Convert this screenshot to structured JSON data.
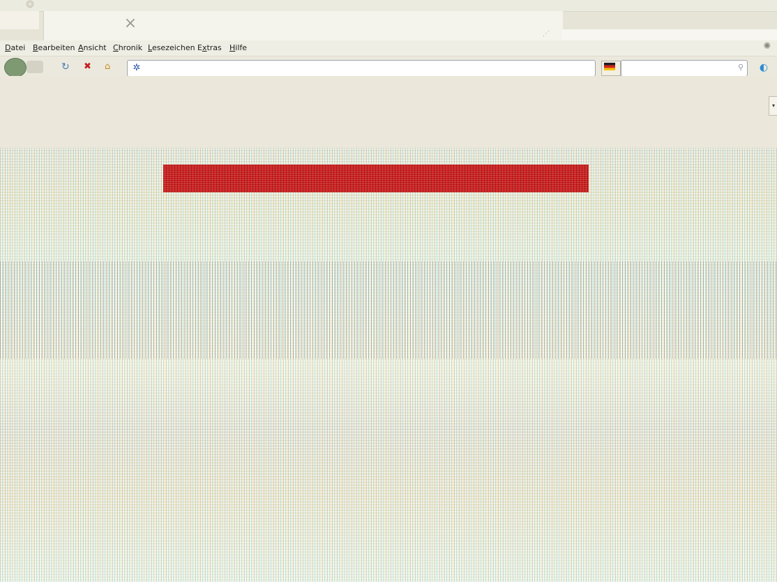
{
  "menubar": {
    "items": [
      {
        "pre": "",
        "acc": "D",
        "post": "atei"
      },
      {
        "pre": "",
        "acc": "B",
        "post": "earbeiten"
      },
      {
        "pre": "",
        "acc": "A",
        "post": "nsicht"
      },
      {
        "pre": "",
        "acc": "C",
        "post": "hronik"
      },
      {
        "pre": "",
        "acc": "L",
        "post": "esezeichen"
      },
      {
        "pre": "E",
        "acc": "x",
        "post": "tras"
      },
      {
        "pre": "",
        "acc": "H",
        "post": "ilfe"
      }
    ]
  },
  "icons": {
    "tab_close": "×",
    "throbber": "✺",
    "titlebar_spinner": "❂",
    "site_icon": "✲",
    "reload": "↻",
    "stop": "✖",
    "home": "⌂",
    "search_go": "⚲",
    "extra": "◐",
    "dropdown_arrow": "▾",
    "small_graphic": "⋰"
  },
  "colors": {
    "banner": "#cf1f1f"
  }
}
